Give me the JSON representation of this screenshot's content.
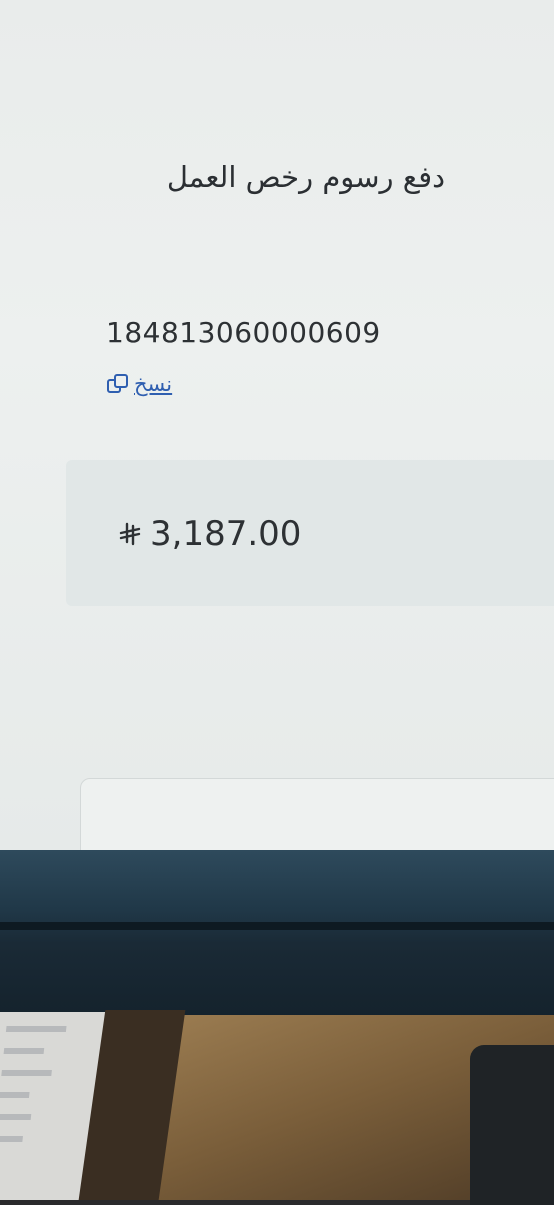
{
  "page": {
    "title": "دفع رسوم رخص العمل",
    "reference_number": "184813060000609",
    "copy_label": "نسخ",
    "copy_icon": "copy-icon",
    "currency_icon": "saudi-riyal-icon",
    "amount": "3,187.00"
  },
  "colors": {
    "screen_bg": "#eceeed",
    "text": "#2d3134",
    "link": "#2f5fb0",
    "panel": "#e1e7e7"
  }
}
